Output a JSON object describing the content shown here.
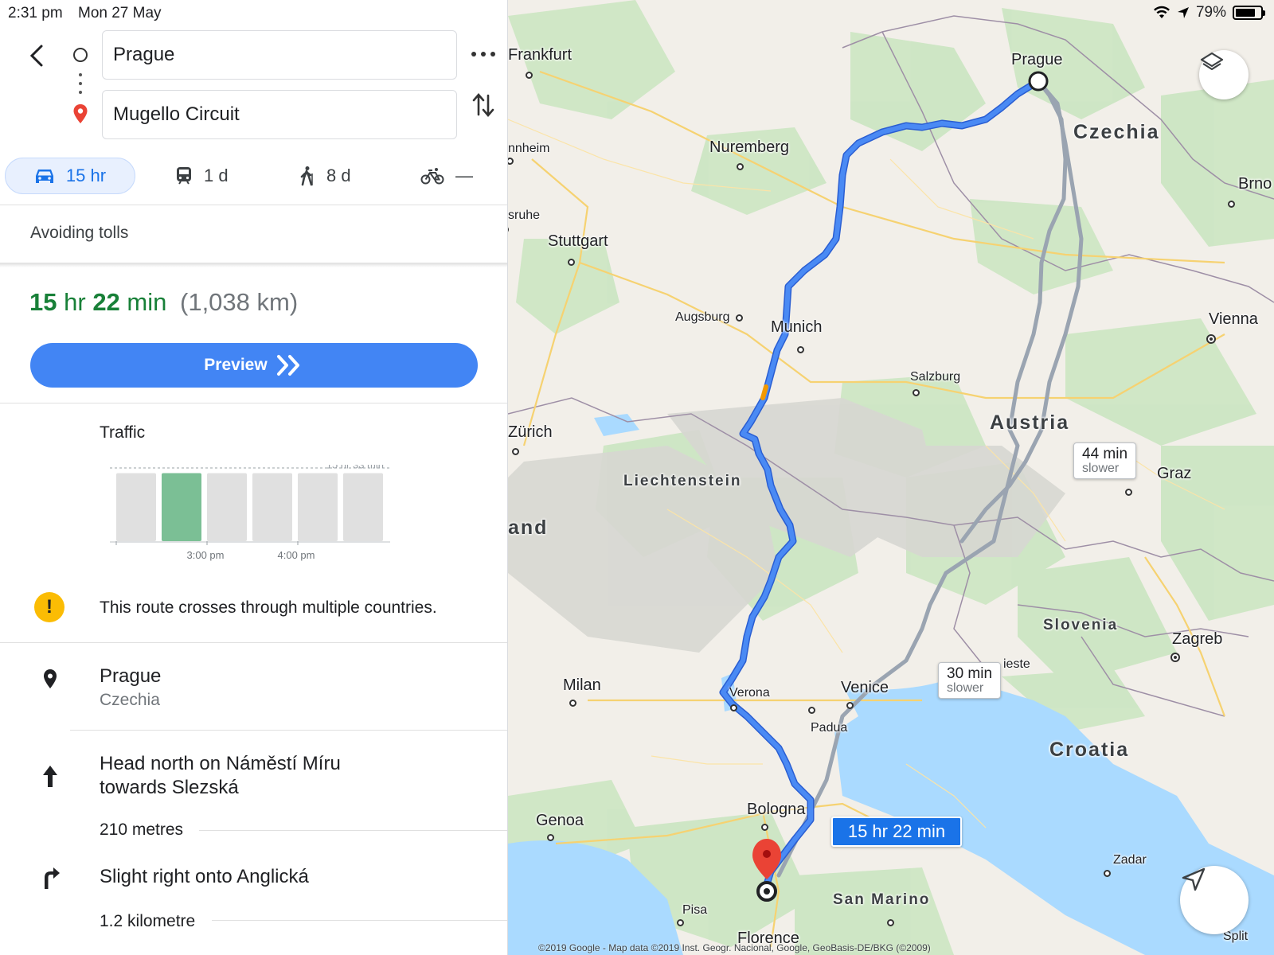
{
  "status_bar": {
    "time": "2:31 pm",
    "date": "Mon 27 May",
    "battery": "79%",
    "battery_level": 0.79
  },
  "directions": {
    "origin": "Prague",
    "destination": "Mugello Circuit",
    "modes": [
      {
        "label": "15 hr",
        "icon": "car-icon",
        "selected": true
      },
      {
        "label": "1 d",
        "icon": "train-icon"
      },
      {
        "label": "8 d",
        "icon": "walking-icon"
      },
      {
        "label": "—",
        "icon": "bicycle-icon"
      }
    ],
    "options_text": "Avoiding tolls"
  },
  "summary": {
    "hours": "15",
    "hours_unit": "hr",
    "minutes": "22",
    "minutes_unit": "min",
    "distance": "(1,038 km)",
    "accent_color": "#188038"
  },
  "preview_button": {
    "label": "Preview"
  },
  "traffic": {
    "title": "Traffic",
    "peak_label": "15 hr 33 min",
    "tick_labels": [
      "3:00 pm",
      "4:00 pm"
    ],
    "bars": [
      {
        "value": 0.93,
        "current": false
      },
      {
        "value": 0.93,
        "current": true
      },
      {
        "value": 0.93,
        "current": false
      },
      {
        "value": 0.93,
        "current": false
      },
      {
        "value": 0.93,
        "current": false
      },
      {
        "value": 0.93,
        "current": false
      }
    ],
    "current_color": "#7bbf95",
    "bar_color": "#e0e0e0"
  },
  "warning": {
    "text": "This route crosses through multiple countries."
  },
  "steps": [
    {
      "icon": "location-pin-icon",
      "title": "Prague",
      "subtitle": "Czechia"
    },
    {
      "icon": "arrow-up-icon",
      "title_line1": "Head north on Náměstí Míru",
      "title_line2": "towards Slezská",
      "distance": "210 metres"
    },
    {
      "icon": "slight-right-icon",
      "title": "Slight right onto Anglická",
      "distance": "1.2 kilometre"
    }
  ],
  "map": {
    "labels": {
      "prague": "Prague",
      "czechia": "Czechia",
      "frankfurt": "Frankfurt",
      "mannheim": "nnheim",
      "nuremberg": "Nuremberg",
      "karlsruhe": "sruhe",
      "stuttgart": "Stuttgart",
      "brno": "Brno",
      "augsburg": "Augsburg",
      "munich": "Munich",
      "vienna": "Vienna",
      "salzburg": "Salzburg",
      "zurich": "Zürich",
      "austria": "Austria",
      "liechtenstein": "Liechtenstein",
      "graz": "Graz",
      "land": "and",
      "slovenia": "Slovenia",
      "zagreb": "Zagreb",
      "milan": "Milan",
      "verona": "Verona",
      "venice": "Venice",
      "trieste": "ieste",
      "padua": "Padua",
      "croatia": "Croatia",
      "bologna": "Bologna",
      "genoa": "Genoa",
      "zadar": "Zadar",
      "san_marino": "San Marino",
      "pisa": "Pisa",
      "florence": "Florence",
      "split": "Split"
    },
    "alt_routes": [
      {
        "time": "44 min",
        "note": "slower"
      },
      {
        "time": "30 min",
        "note": "slower"
      }
    ],
    "route_label": "15 hr 22 min",
    "route_color": "#4a8af4",
    "alt_route_color": "#9aa4b1",
    "attribution": "©2019 Google - Map data ©2019 Inst. Geogr. Nacional, Google, GeoBasis-DE/BKG (©2009)"
  }
}
